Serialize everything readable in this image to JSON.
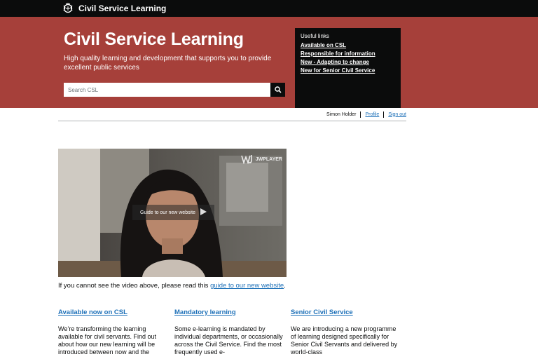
{
  "header": {
    "brand_label": "Civil Service Learning",
    "brand_icon": "crest-icon"
  },
  "hero": {
    "title": "Civil Service Learning",
    "subtitle": "High quality learning and development that supports you to provide excellent public services",
    "search_placeholder": "Search CSL",
    "search_icon": "search-icon"
  },
  "useful_links": {
    "heading": "Useful links",
    "items": [
      {
        "label": "Available on CSL"
      },
      {
        "label": "Responsible for information"
      },
      {
        "label": "New - Adapting to change"
      },
      {
        "label": "New for Senior Civil Service"
      }
    ]
  },
  "account": {
    "user_name": "Simon Holder",
    "profile_label": "Profile",
    "signout_label": "Sign out"
  },
  "video": {
    "player_brand": "JWPLAYER",
    "overlay_label": "Guide to our new website",
    "caption_prefix": "If you cannot see the video above, please read this ",
    "caption_link": "guide to our new website",
    "caption_suffix": "."
  },
  "columns": [
    {
      "title": "Available now on CSL",
      "text": "We’re transforming the learning available for civil servants. Find out about how our new learning will be introduced between now and the"
    },
    {
      "title": "Mandatory learning",
      "text": "Some e-learning is mandated by individual departments, or occasionally across the Civil Service. Find the most frequently used e-"
    },
    {
      "title": "Senior Civil Service",
      "text": "We are introducing a new programme of learning designed specifically for Senior Civil Servants and delivered by world-class"
    }
  ],
  "colors": {
    "hero_background": "#a6403a",
    "topbar_background": "#0b0c0c",
    "link": "#1d70b8"
  }
}
